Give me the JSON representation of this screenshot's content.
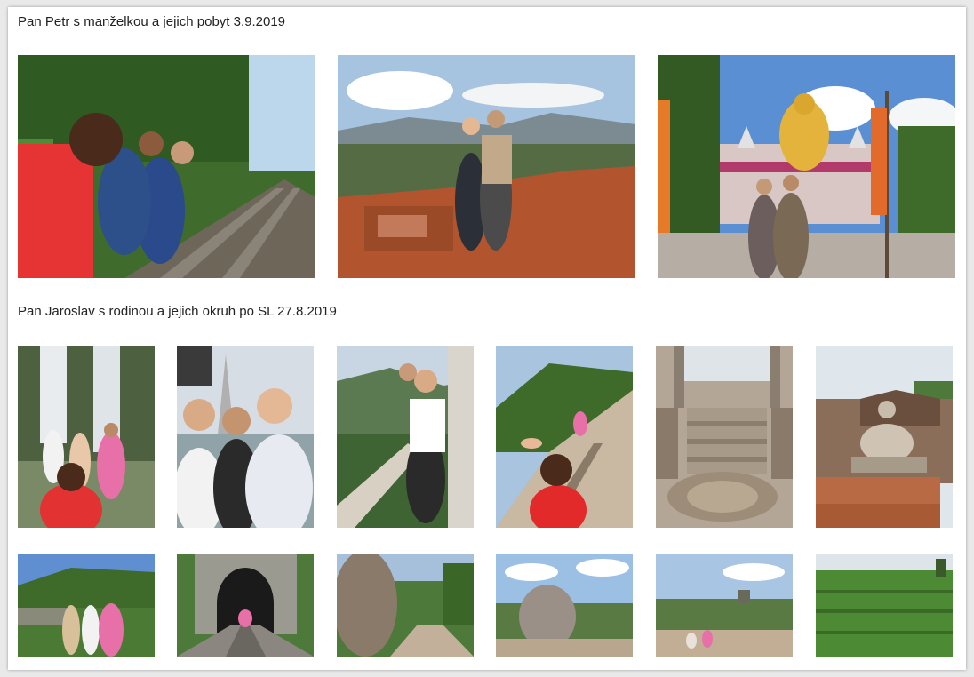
{
  "sections": [
    {
      "title": "Pan Petr s manželkou a jejich pobyt 3.9.2019",
      "photos": [
        {
          "icon": "selfie-railway-photo"
        },
        {
          "icon": "sigiriya-view-photo"
        },
        {
          "icon": "golden-buddha-temple-photo"
        }
      ]
    },
    {
      "title": "Pan Jaroslav s rodinou a jejich okruh po SL 27.8.2019",
      "photos": [
        {
          "icon": "waterfall-group-photo"
        },
        {
          "icon": "group-selfie-temple-photo"
        },
        {
          "icon": "mountain-railing-photo"
        },
        {
          "icon": "nine-arch-bridge-photo"
        },
        {
          "icon": "moonstone-stairs-photo"
        },
        {
          "icon": "buddha-statue-photo"
        },
        {
          "icon": "bridge-group-photo"
        },
        {
          "icon": "railway-tunnel-photo"
        },
        {
          "icon": "boulder-path-photo"
        },
        {
          "icon": "balanced-rock-photo"
        },
        {
          "icon": "rock-summit-view-photo"
        },
        {
          "icon": "tea-plantation-photo"
        }
      ]
    }
  ]
}
